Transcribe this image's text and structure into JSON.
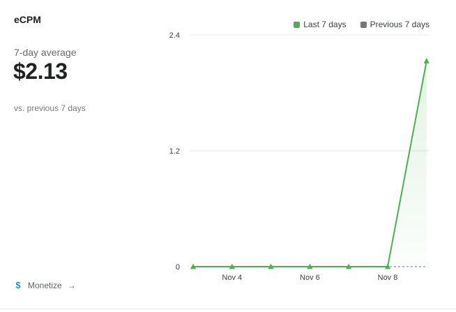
{
  "card": {
    "title": "eCPM",
    "average_label": "7-day average",
    "average_value": "$2.13",
    "comparison_label": "vs. previous 7 days",
    "link": {
      "icon": "$",
      "label": "Monetize",
      "arrow": "→"
    }
  },
  "chart_data": {
    "type": "line",
    "x": [
      "Nov 3",
      "Nov 4",
      "Nov 5",
      "Nov 6",
      "Nov 7",
      "Nov 8",
      "Nov 9"
    ],
    "x_tick_labels": [
      "Nov 4",
      "Nov 6",
      "Nov 8"
    ],
    "y_tick_labels": [
      "0",
      "1.2",
      "2.4"
    ],
    "ylim": [
      0,
      2.4
    ],
    "grid": true,
    "legend_position": "top-right",
    "series": [
      {
        "name": "Last 7 days",
        "color": "#4caf50",
        "marker": "triangle",
        "values": [
          0,
          0,
          0,
          0,
          0,
          0,
          2.13
        ]
      },
      {
        "name": "Previous 7 days",
        "color": "#757575",
        "style": "dashed",
        "values": [
          0,
          0,
          0,
          0,
          0,
          0,
          0
        ]
      }
    ]
  }
}
